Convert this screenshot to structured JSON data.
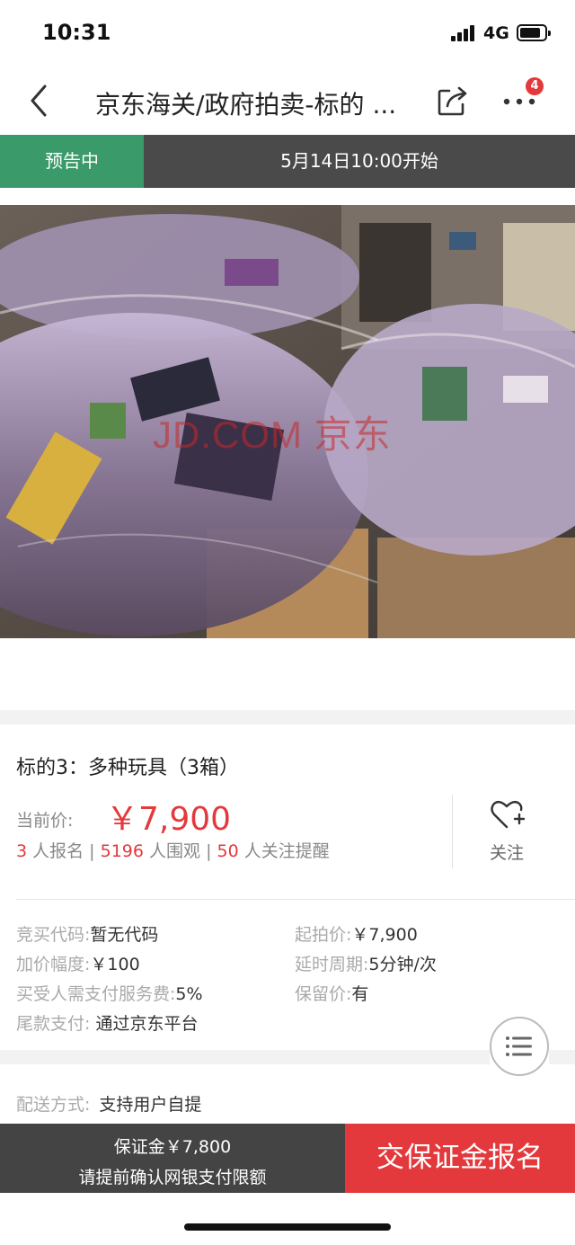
{
  "status_bar": {
    "time": "10:31",
    "network": "4G",
    "battery_level": 0.8
  },
  "nav": {
    "title": "京东海关/政府拍卖-标的 ...",
    "more_badge": "4",
    "icons": {
      "back": "back-icon",
      "share": "share-icon",
      "more": "more-icon"
    }
  },
  "auction_status": {
    "state": "预告中",
    "start_time": "5月14日10:00开始"
  },
  "image": {
    "watermark": "JD.COM 京东"
  },
  "lot": {
    "title": "标的3：多种玩具（3箱）",
    "price_label": "当前价:",
    "price": "￥7,900",
    "registrations": "3",
    "registrations_text": " 人报名 | ",
    "views": "5196",
    "views_text": " 人围观 | ",
    "followers": "50",
    "followers_text": " 人关注提醒",
    "follow_label": "关注"
  },
  "details": {
    "code_label": "竞买代码:",
    "code_value": "暂无代码",
    "start_price_label": "起拍价:",
    "start_price_value": "￥7,900",
    "increment_label": "加价幅度:",
    "increment_value": "￥100",
    "delay_label": "延时周期:",
    "delay_value": "5分钟/次",
    "fee_label": "买受人需支付服务费:",
    "fee_value": "5%",
    "reserve_label": "保留价:",
    "reserve_value": "有",
    "final_pay_label": "尾款支付:",
    "final_pay_value": " 通过京东平台"
  },
  "delivery": {
    "label": "配送方式:",
    "value": "支持用户自提"
  },
  "bottom": {
    "deposit": "保证金￥7,800",
    "deposit_note": "请提前确认网银支付限额",
    "signup": "交保证金报名"
  },
  "colors": {
    "accent_red": "#e4393c",
    "status_green": "#3a9a6a",
    "dark_bar": "#444444"
  }
}
